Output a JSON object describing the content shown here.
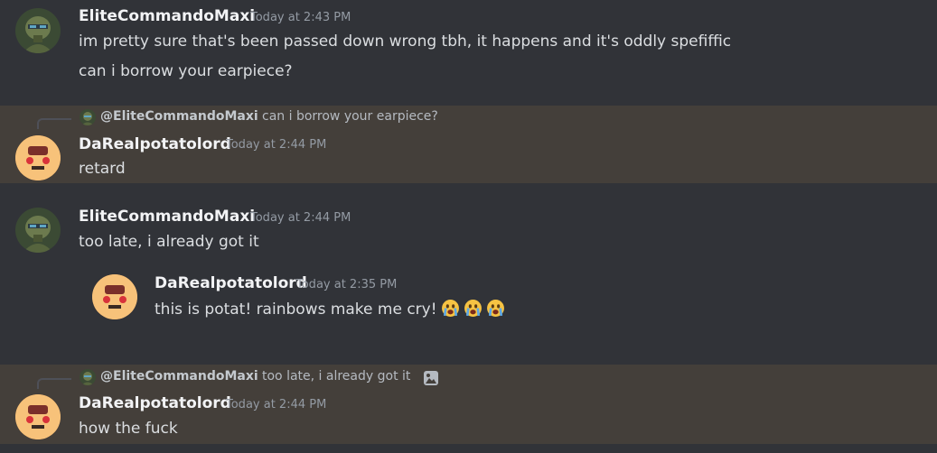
{
  "messages": [
    {
      "author": "EliteCommandoMaxi",
      "timestamp": "Today at 2:43 PM",
      "lines": [
        "im pretty sure that's been passed down wrong tbh, it happens and it's oddly spefiffic",
        "can i borrow your earpiece?"
      ]
    },
    {
      "reply": {
        "author": "@EliteCommandoMaxi",
        "text": "can i borrow your earpiece?"
      },
      "author": "DaRealpotatolord",
      "timestamp": "Today at 2:44 PM",
      "lines": [
        "retard"
      ]
    },
    {
      "author": "EliteCommandoMaxi",
      "timestamp": "Today at 2:44 PM",
      "lines": [
        "too late, i already got it"
      ],
      "embed": {
        "author": "DaRealpotatolord",
        "timestamp": "Today at 2:35 PM",
        "text": "this is potat! rainbows make me cry!",
        "emoji": [
          "crying-face",
          "crying-face",
          "crying-face"
        ]
      }
    },
    {
      "reply": {
        "author": "@EliteCommandoMaxi",
        "text": "too late, i already got it",
        "icon": "image-icon"
      },
      "author": "DaRealpotatolord",
      "timestamp": "Today at 2:44 PM",
      "lines": [
        "how the fuck"
      ]
    }
  ],
  "colors": {
    "background": "#313338",
    "highlight": "#443f3a",
    "username": "#f2f3f5",
    "timestamp": "#949ba4",
    "text": "#dbdee1"
  }
}
